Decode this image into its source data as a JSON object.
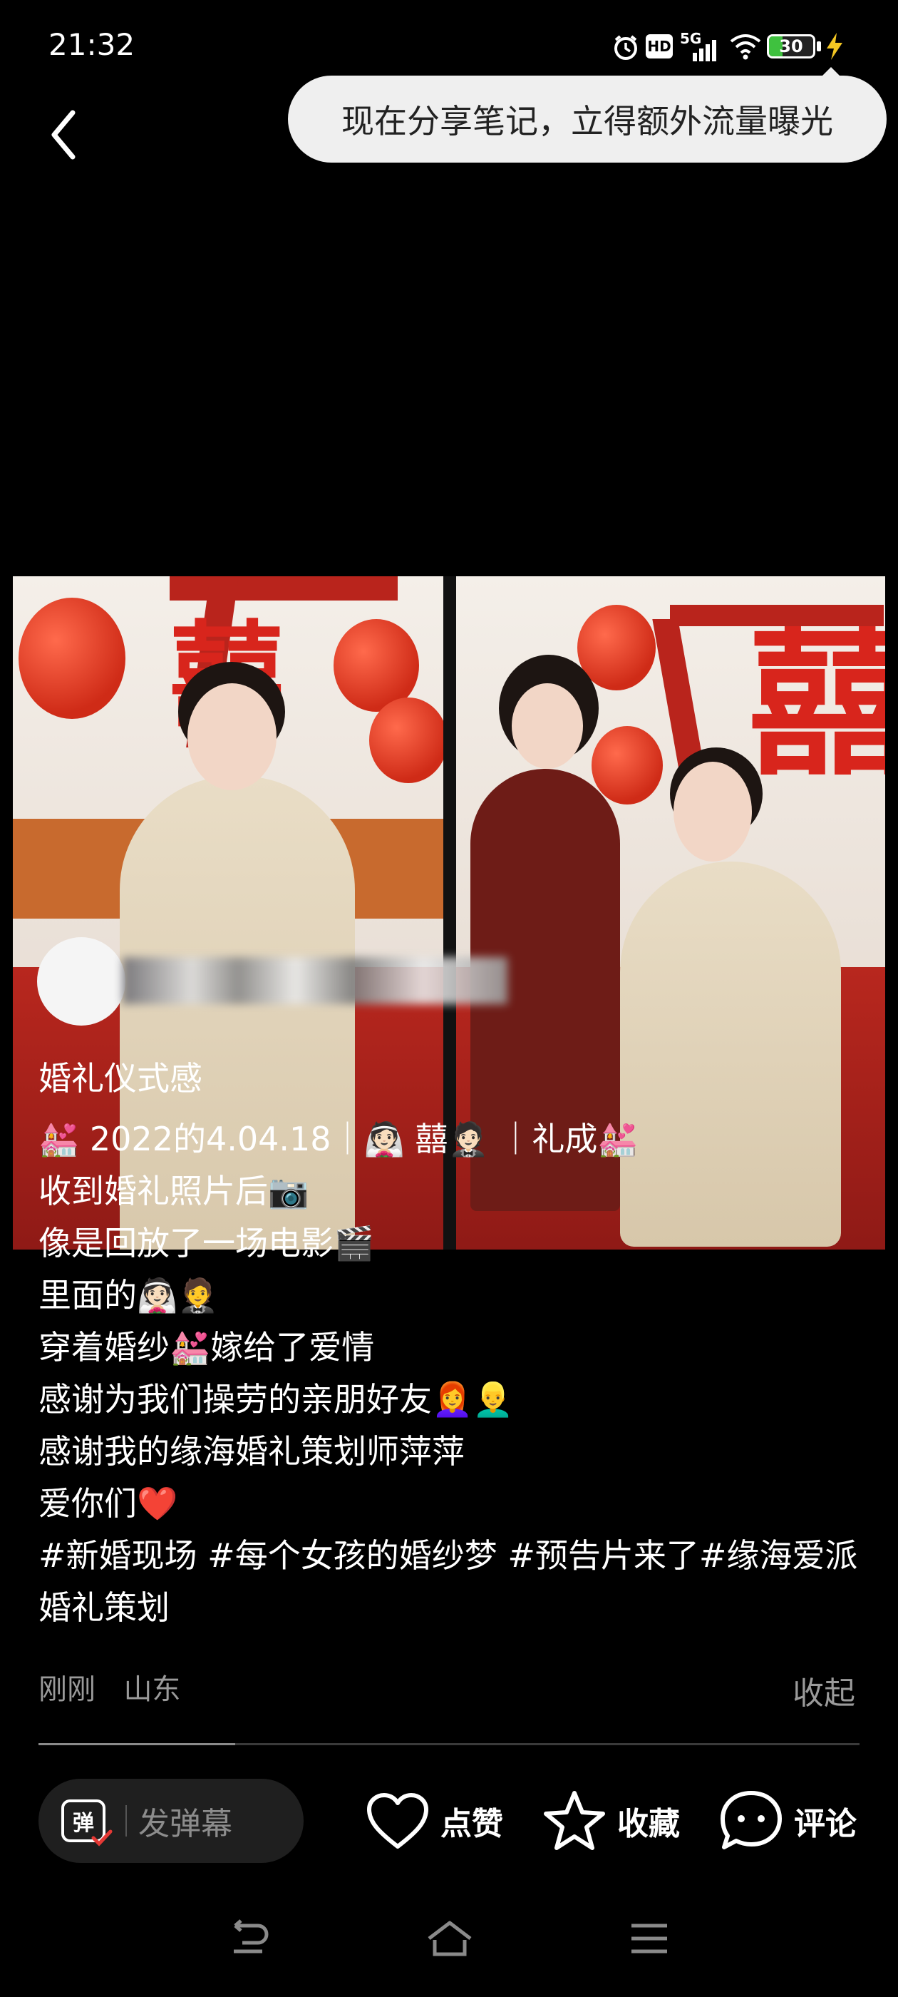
{
  "status_bar": {
    "time": "21:32",
    "network": "5G",
    "hd": "HD",
    "battery": "30",
    "battery_level": 0.3,
    "icons": [
      "alarm-icon",
      "hd-icon",
      "5g-signal-icon",
      "wifi-icon",
      "battery-icon",
      "charging-icon"
    ]
  },
  "header": {
    "back_icon": "back-arrow-icon"
  },
  "share_tip": {
    "text": "现在分享笔记，立得额外流量曝光"
  },
  "post": {
    "caption": {
      "title": "婚礼仪式感",
      "line1": "💒 2022的4.04.18｜👰🏻 囍🤵🏻 ｜礼成💒",
      "line2": "收到婚礼照片后📷",
      "line3": "像是回放了一场电影🎬",
      "line4": "里面的👰🏻🤵",
      "line5": "穿着婚纱💒嫁给了爱情",
      "line6": "感谢为我们操劳的亲朋好友👩‍🦰👱‍♂️",
      "line7": "感谢我的缘海婚礼策划师萍萍",
      "line8": "爱你们❤️",
      "tags": "#新婚现场 #每个女孩的婚纱梦 #预告片来了#缘海爱派婚礼策划"
    },
    "meta": {
      "time": "刚刚",
      "location": "山东"
    },
    "collapse_label": "收起",
    "progress": 0.24
  },
  "bottom_bar": {
    "danmaku_icon": "弹",
    "danmaku_placeholder": "发弹幕",
    "like_label": "点赞",
    "collect_label": "收藏",
    "comment_label": "评论"
  },
  "nav_bar": {
    "icons": [
      "back-nav-icon",
      "home-nav-icon",
      "menu-nav-icon"
    ]
  },
  "colors": {
    "background": "#000000",
    "tip_bg": "#efefef",
    "accent_red": "#e53935",
    "battery_green": "#3fc13f"
  }
}
